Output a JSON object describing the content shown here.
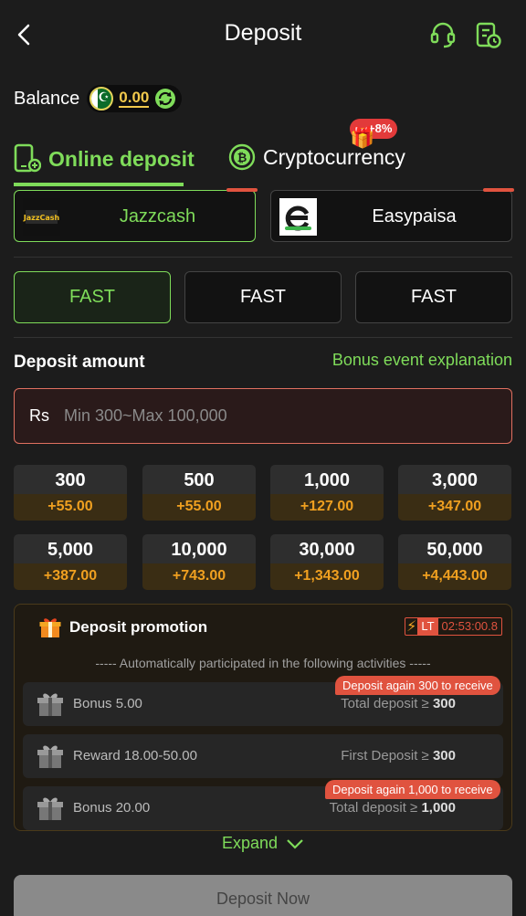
{
  "header": {
    "title": "Deposit"
  },
  "balance": {
    "label": "Balance",
    "amount": "0.00"
  },
  "tabs": [
    {
      "label": "Online deposit",
      "active": true
    },
    {
      "label": "Cryptocurrency",
      "badge": "+8%"
    }
  ],
  "methods": [
    {
      "label": "Jazzcash",
      "logo_text": "JazzCash",
      "active": true
    },
    {
      "label": "Easypaisa"
    }
  ],
  "channels": [
    "FAST",
    "FAST",
    "FAST"
  ],
  "deposit_amount": {
    "heading": "Deposit amount",
    "bonus_link": "Bonus event explanation",
    "currency": "Rs",
    "placeholder": "Min 300~Max 100,000"
  },
  "amount_options": [
    {
      "amount": "300",
      "bonus": "+55.00"
    },
    {
      "amount": "500",
      "bonus": "+55.00"
    },
    {
      "amount": "1,000",
      "bonus": "+127.00"
    },
    {
      "amount": "3,000",
      "bonus": "+347.00"
    },
    {
      "amount": "5,000",
      "bonus": "+387.00"
    },
    {
      "amount": "10,000",
      "bonus": "+743.00"
    },
    {
      "amount": "30,000",
      "bonus": "+1,343.00"
    },
    {
      "amount": "50,000",
      "bonus": "+4,443.00"
    }
  ],
  "promotion": {
    "title": "Deposit promotion",
    "timer_label": "LT",
    "timer": "02:53:00.8",
    "note": "----- Automatically participated in the following activities -----",
    "activities": [
      {
        "name": "Bonus 5.00",
        "condition_prefix": "Total deposit ≥",
        "condition_value": "300",
        "tip": "Deposit again 300 to receive"
      },
      {
        "name": "Reward 18.00-50.00",
        "condition_prefix": "First Deposit ≥",
        "condition_value": "300"
      },
      {
        "name": "Bonus 20.00",
        "condition_prefix": "Total deposit ≥",
        "condition_value": "1,000",
        "tip": "Deposit again 1,000 to receive"
      }
    ],
    "expand_label": "Expand"
  },
  "submit": {
    "label": "Deposit Now"
  },
  "colors": {
    "accent": "#7fdc5a",
    "bonus": "#f0a020",
    "alert": "#e0533f",
    "balance": "#f2c94c"
  }
}
